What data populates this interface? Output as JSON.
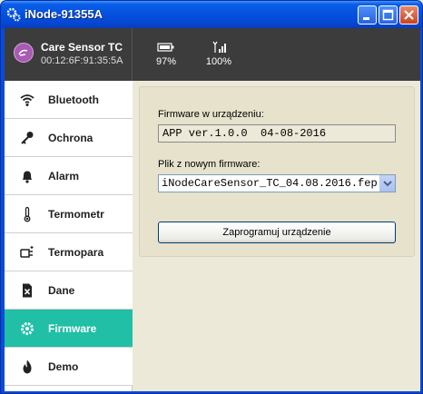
{
  "window": {
    "title": "iNode-91355A"
  },
  "header": {
    "device_name": "Care Sensor TC",
    "mac": "00:12:6F:91:35:5A",
    "battery": "97%",
    "signal": "100%"
  },
  "sidebar": {
    "items": [
      {
        "label": "Bluetooth",
        "icon": "wifi-icon"
      },
      {
        "label": "Ochrona",
        "icon": "key-icon"
      },
      {
        "label": "Alarm",
        "icon": "bell-icon"
      },
      {
        "label": "Termometr",
        "icon": "thermometer-icon"
      },
      {
        "label": "Termopara",
        "icon": "thermocouple-icon"
      },
      {
        "label": "Dane",
        "icon": "data-file-icon"
      },
      {
        "label": "Firmware",
        "icon": "gear-icon"
      },
      {
        "label": "Demo",
        "icon": "flame-icon"
      }
    ],
    "active": "Firmware",
    "active_color": "#20bfa6"
  },
  "main": {
    "device_fw_label": "Firmware w urządzeniu:",
    "device_fw_value": "APP ver.1.0.0  04-08-2016",
    "file_label": "Plik z nowym firmware:",
    "file_value": "iNodeCareSensor_TC_04.08.2016.fep",
    "program_button": "Zaprogramuj urządzenie"
  }
}
